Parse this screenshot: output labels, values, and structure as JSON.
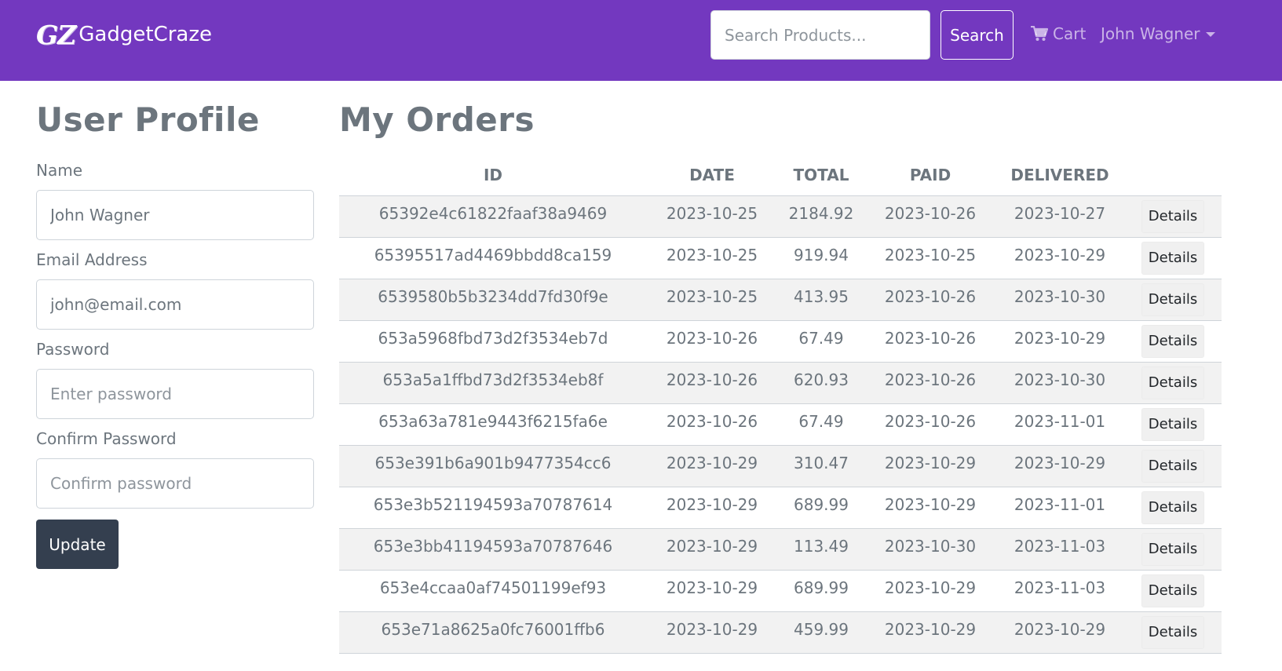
{
  "navbar": {
    "logo_text": "GZ",
    "brand_name": "GadgetCraze",
    "search_placeholder": "Search Products...",
    "search_button": "Search",
    "cart_label": "Cart",
    "user_name": "John Wagner"
  },
  "profile": {
    "title": "User Profile",
    "name_label": "Name",
    "name_value": "John Wagner",
    "email_label": "Email Address",
    "email_value": "john@email.com",
    "password_label": "Password",
    "password_placeholder": "Enter password",
    "confirm_label": "Confirm Password",
    "confirm_placeholder": "Confirm password",
    "update_button": "Update"
  },
  "orders": {
    "title": "My Orders",
    "columns": [
      "ID",
      "DATE",
      "TOTAL",
      "PAID",
      "DELIVERED"
    ],
    "details_label": "Details",
    "rows": [
      {
        "id": "65392e4c61822faaf38a9469",
        "date": "2023-10-25",
        "total": "2184.92",
        "paid": "2023-10-26",
        "delivered": "2023-10-27"
      },
      {
        "id": "65395517ad4469bbdd8ca159",
        "date": "2023-10-25",
        "total": "919.94",
        "paid": "2023-10-25",
        "delivered": "2023-10-29"
      },
      {
        "id": "6539580b5b3234dd7fd30f9e",
        "date": "2023-10-25",
        "total": "413.95",
        "paid": "2023-10-26",
        "delivered": "2023-10-30"
      },
      {
        "id": "653a5968fbd73d2f3534eb7d",
        "date": "2023-10-26",
        "total": "67.49",
        "paid": "2023-10-26",
        "delivered": "2023-10-29"
      },
      {
        "id": "653a5a1ffbd73d2f3534eb8f",
        "date": "2023-10-26",
        "total": "620.93",
        "paid": "2023-10-26",
        "delivered": "2023-10-30"
      },
      {
        "id": "653a63a781e9443f6215fa6e",
        "date": "2023-10-26",
        "total": "67.49",
        "paid": "2023-10-26",
        "delivered": "2023-11-01"
      },
      {
        "id": "653e391b6a901b9477354cc6",
        "date": "2023-10-29",
        "total": "310.47",
        "paid": "2023-10-29",
        "delivered": "2023-10-29"
      },
      {
        "id": "653e3b521194593a70787614",
        "date": "2023-10-29",
        "total": "689.99",
        "paid": "2023-10-29",
        "delivered": "2023-11-01"
      },
      {
        "id": "653e3bb41194593a70787646",
        "date": "2023-10-29",
        "total": "113.49",
        "paid": "2023-10-30",
        "delivered": "2023-11-03"
      },
      {
        "id": "653e4ccaa0af74501199ef93",
        "date": "2023-10-29",
        "total": "689.99",
        "paid": "2023-10-29",
        "delivered": "2023-11-03"
      },
      {
        "id": "653e71a8625a0fc76001ffb6",
        "date": "2023-10-29",
        "total": "459.99",
        "paid": "2023-10-29",
        "delivered": "2023-10-29"
      }
    ]
  },
  "colors": {
    "navbar_bg": "#7338bf",
    "update_button_bg": "#343f4f",
    "stripe_bg": "#f2f2f2"
  },
  "icons": {
    "cart": "shopping-cart-icon",
    "user_menu": "caret-down-icon"
  }
}
